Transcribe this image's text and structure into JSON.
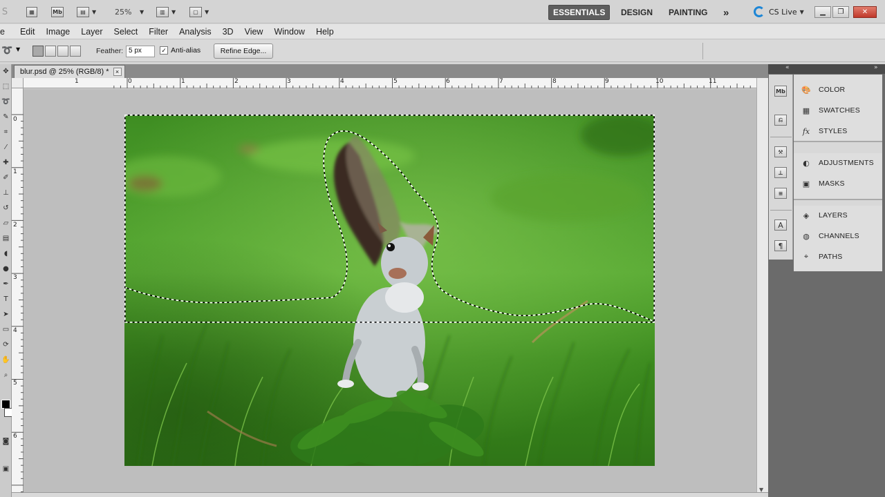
{
  "app_bar": {
    "zoom": "25%",
    "workspaces": {
      "essentials": "ESSENTIALS",
      "design": "DESIGN",
      "painting": "PAINTING",
      "more": "»"
    },
    "cs_live": "CS Live",
    "bridge_label": "Mb"
  },
  "menu": {
    "items": [
      "e",
      "Edit",
      "Image",
      "Layer",
      "Select",
      "Filter",
      "Analysis",
      "3D",
      "View",
      "Window",
      "Help"
    ]
  },
  "options": {
    "feather_label": "Feather:",
    "feather_value": "5 px",
    "antialias_label": "Anti-alias",
    "antialias_checked": "✓",
    "refine_edge": "Refine Edge..."
  },
  "document": {
    "tab_title": "blur.psd @ 25% (RGB/8) *",
    "close": "×",
    "ruler_top_labels": [
      "1",
      "0",
      "1",
      "2",
      "3",
      "4",
      "5",
      "6",
      "7",
      "8",
      "9",
      "10",
      "11"
    ],
    "ruler_left_labels": [
      "0",
      "1",
      "2",
      "3",
      "4",
      "5",
      "6"
    ]
  },
  "panels": {
    "group1": [
      "COLOR",
      "SWATCHES",
      "STYLES"
    ],
    "group2": [
      "ADJUSTMENTS",
      "MASKS"
    ],
    "group3": [
      "LAYERS",
      "CHANNELS",
      "PATHS"
    ]
  },
  "icons": {
    "bridge": "bridge-icon",
    "cs_live": "cs-live-icon",
    "minimize": "minimize-icon",
    "restore": "restore-icon",
    "close": "close-icon"
  },
  "colors": {
    "active_workspace": "#5e5e5e",
    "canvas_bg": "#bebebe",
    "cs_live_blue": "#1d86d6"
  }
}
